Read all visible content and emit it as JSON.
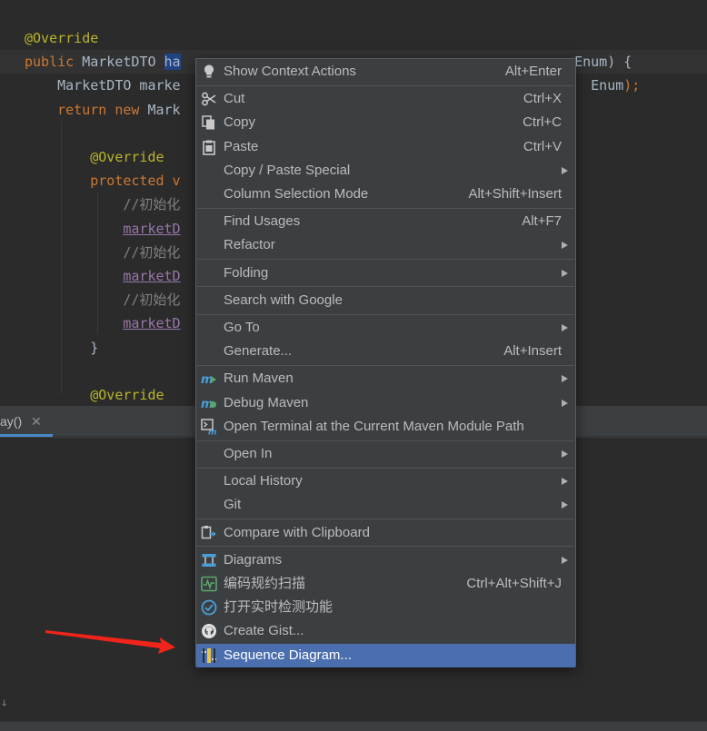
{
  "editor": {
    "lines": [
      {
        "parts": [
          {
            "t": "@Override",
            "c": "ann"
          }
        ]
      },
      {
        "parts": [
          {
            "t": "public ",
            "c": "kw"
          },
          {
            "t": "MarketDTO "
          },
          {
            "t": "ha",
            "c": "sel"
          },
          {
            "t": "                                                "
          },
          {
            "t": "Enum) {"
          }
        ]
      },
      {
        "parts": [
          {
            "t": "    MarketDTO marke"
          },
          {
            "t": "                                                  "
          },
          {
            "t": "Enum"
          },
          {
            "t": ");",
            "c": "kw"
          }
        ]
      },
      {
        "parts": [
          {
            "t": "    "
          },
          {
            "t": "return new ",
            "c": "kw"
          },
          {
            "t": "Mark"
          }
        ]
      },
      {
        "parts": [
          {
            "t": ""
          }
        ]
      },
      {
        "parts": [
          {
            "t": "        "
          },
          {
            "t": "@Override",
            "c": "ann"
          }
        ]
      },
      {
        "parts": [
          {
            "t": "        "
          },
          {
            "t": "protected v",
            "c": "kw"
          }
        ]
      },
      {
        "parts": [
          {
            "t": "            "
          },
          {
            "t": "//初始化",
            "c": "cmt"
          }
        ]
      },
      {
        "parts": [
          {
            "t": "            "
          },
          {
            "t": "marketD",
            "c": "field"
          }
        ]
      },
      {
        "parts": [
          {
            "t": "            "
          },
          {
            "t": "//初始化",
            "c": "cmt"
          }
        ]
      },
      {
        "parts": [
          {
            "t": "            "
          },
          {
            "t": "marketD",
            "c": "field"
          }
        ]
      },
      {
        "parts": [
          {
            "t": "            "
          },
          {
            "t": "//初始化",
            "c": "cmt"
          }
        ]
      },
      {
        "parts": [
          {
            "t": "            "
          },
          {
            "t": "marketD",
            "c": "field"
          }
        ]
      },
      {
        "parts": [
          {
            "t": "        }"
          }
        ]
      },
      {
        "parts": [
          {
            "t": ""
          }
        ]
      },
      {
        "parts": [
          {
            "t": "        "
          },
          {
            "t": "@Override",
            "c": "ann"
          }
        ]
      }
    ]
  },
  "tool_window": {
    "tab_label": "ay()",
    "tab_close": "✕",
    "side_mark": "ↆ"
  },
  "menu": {
    "items": [
      {
        "label": "Show Context Actions",
        "shortcut": "Alt+Enter",
        "icon": "lightbulb-icon"
      },
      {
        "sep": true
      },
      {
        "label": "Cut",
        "shortcut": "Ctrl+X",
        "icon": "scissors-icon"
      },
      {
        "label": "Copy",
        "shortcut": "Ctrl+C",
        "icon": "copy-icon"
      },
      {
        "label": "Paste",
        "shortcut": "Ctrl+V",
        "icon": "clipboard-icon"
      },
      {
        "label": "Copy / Paste Special",
        "submenu": true
      },
      {
        "label": "Column Selection Mode",
        "shortcut": "Alt+Shift+Insert"
      },
      {
        "sep": true
      },
      {
        "label": "Find Usages",
        "shortcut": "Alt+F7"
      },
      {
        "label": "Refactor",
        "submenu": true
      },
      {
        "sep": true
      },
      {
        "label": "Folding",
        "submenu": true
      },
      {
        "sep": true
      },
      {
        "label": "Search with Google"
      },
      {
        "sep": true
      },
      {
        "label": "Go To",
        "submenu": true
      },
      {
        "label": "Generate...",
        "shortcut": "Alt+Insert"
      },
      {
        "sep": true
      },
      {
        "label": "Run Maven",
        "submenu": true,
        "icon": "maven-run-icon"
      },
      {
        "label": "Debug Maven",
        "submenu": true,
        "icon": "maven-debug-icon"
      },
      {
        "label": "Open Terminal at the Current Maven Module Path",
        "icon": "maven-terminal-icon"
      },
      {
        "sep": true
      },
      {
        "label": "Open In",
        "submenu": true
      },
      {
        "sep": true
      },
      {
        "label": "Local History",
        "submenu": true
      },
      {
        "label": "Git",
        "submenu": true
      },
      {
        "sep": true
      },
      {
        "label": "Compare with Clipboard",
        "icon": "compare-clipboard-icon"
      },
      {
        "sep": true
      },
      {
        "label": "Diagrams",
        "submenu": true,
        "icon": "diagram-icon"
      },
      {
        "label": "编码规约扫描",
        "shortcut": "Ctrl+Alt+Shift+J",
        "icon": "code-scan-icon"
      },
      {
        "label": "打开实时检测功能",
        "icon": "realtime-check-icon"
      },
      {
        "label": "Create Gist...",
        "icon": "github-icon"
      },
      {
        "label": "Sequence Diagram...",
        "icon": "sequence-diagram-icon",
        "selected": true
      }
    ]
  },
  "colors": {
    "editor_bg": "#2b2b2b",
    "menu_bg": "#3c3f41",
    "selection": "#4b6eaf",
    "annotation": "#bbb529",
    "keyword": "#cc7832",
    "arrow": "#f0241a"
  }
}
